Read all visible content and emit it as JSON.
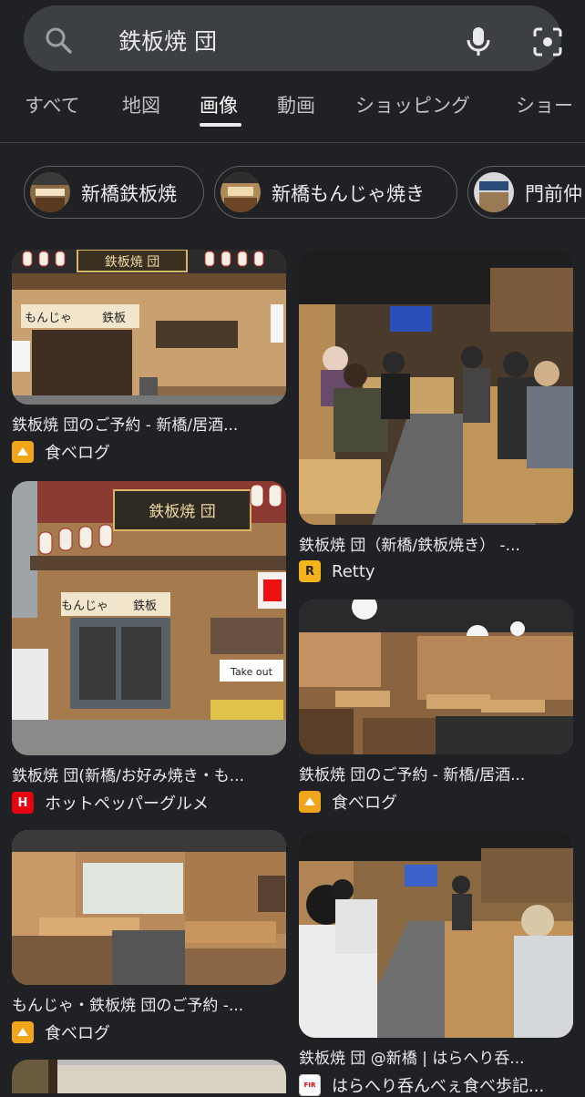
{
  "search": {
    "query": "鉄板焼 団"
  },
  "tabs": [
    {
      "label": "すべて"
    },
    {
      "label": "地図"
    },
    {
      "label": "画像"
    },
    {
      "label": "動画"
    },
    {
      "label": "ショッピング"
    },
    {
      "label": "ショー"
    }
  ],
  "active_tab": "画像",
  "chips": [
    {
      "label": "新橋鉄板焼"
    },
    {
      "label": "新橋もんじゃ焼き"
    },
    {
      "label": "門前仲"
    }
  ],
  "results": [
    {
      "title": "鉄板焼 団のご予約 - 新橋/居酒...",
      "source": "食べログ",
      "sign": "鉄板焼 団",
      "noren_left": "もんじゃ",
      "noren_right": "鉄板"
    },
    {
      "title": "鉄板焼 団（新橋/鉄板焼き） -...",
      "source": "Retty"
    },
    {
      "title": "鉄板焼 団(新橋/お好み焼き・も...",
      "source": "ホットペッパーグルメ",
      "sign": "鉄板焼 団",
      "noren_left": "もんじゃ",
      "noren_right": "鉄板",
      "takeout": "Take out"
    },
    {
      "title": "鉄板焼 団のご予約 - 新橋/居酒...",
      "source": "食べログ"
    },
    {
      "title": "もんじゃ・鉄板焼 団のご予約 -...",
      "source": "食べログ"
    },
    {
      "title": "鉄板焼 団 @新橋 | はらへり呑...",
      "source": "はらへり呑んべぇ食べ歩記..."
    }
  ],
  "favicons": {
    "tabelog": "#f0a51a",
    "retty": "R",
    "hotpepper": "H",
    "harahera": "FIR"
  }
}
